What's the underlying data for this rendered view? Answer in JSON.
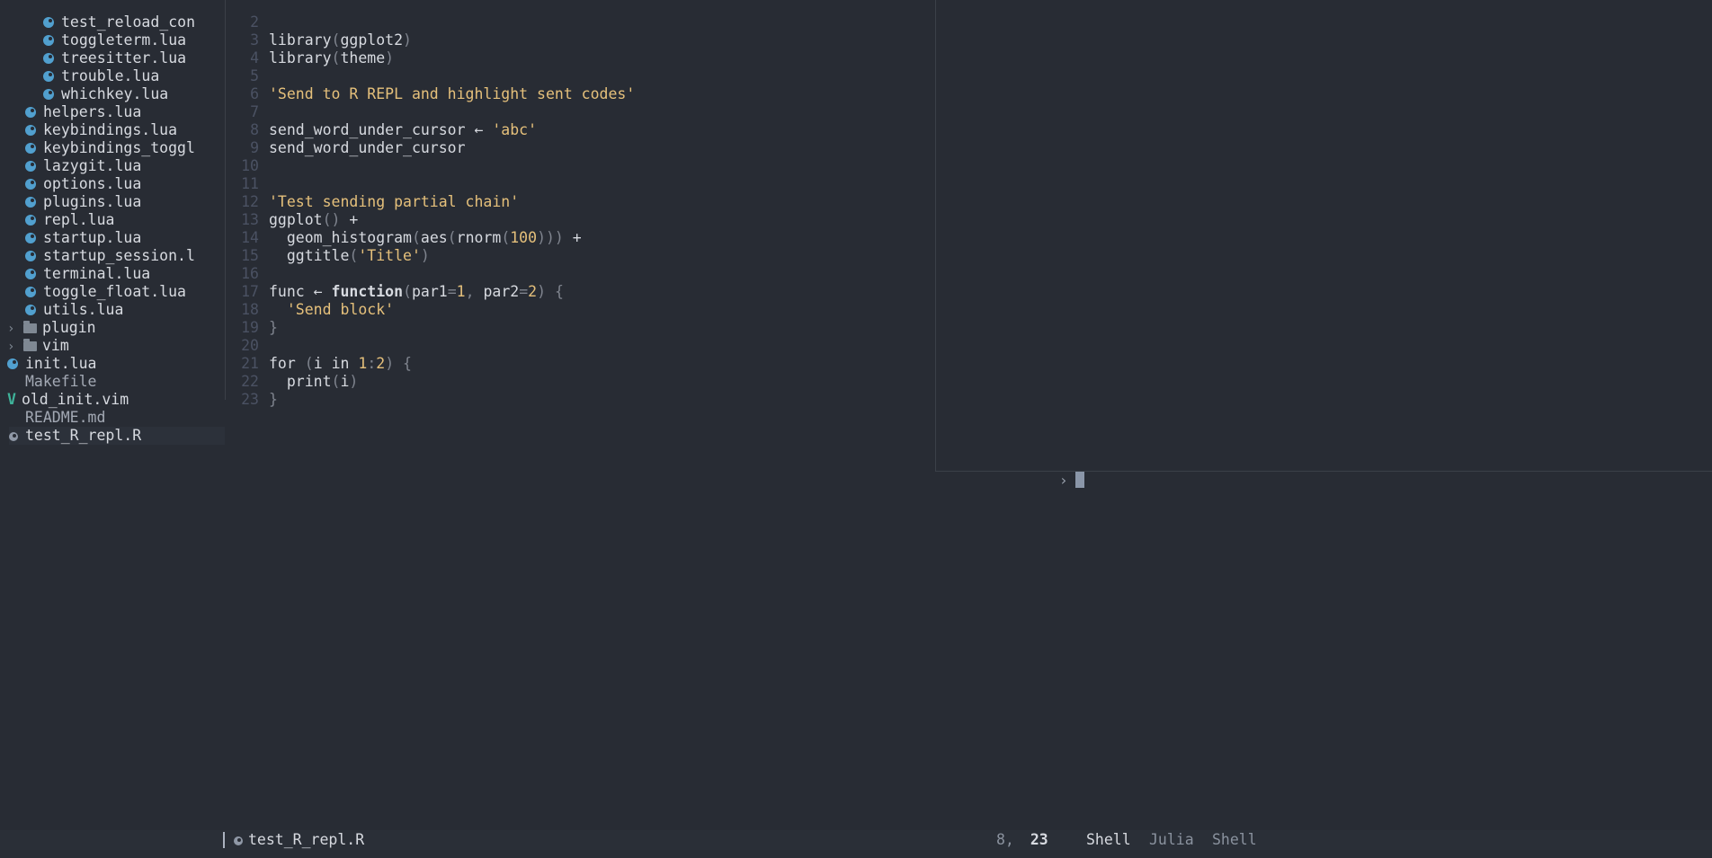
{
  "file_tree": {
    "items": [
      {
        "label": "test_reload_con",
        "indent": 2,
        "kind": "lua"
      },
      {
        "label": "toggleterm.lua",
        "indent": 2,
        "kind": "lua"
      },
      {
        "label": "treesitter.lua",
        "indent": 2,
        "kind": "lua"
      },
      {
        "label": "trouble.lua",
        "indent": 2,
        "kind": "lua"
      },
      {
        "label": "whichkey.lua",
        "indent": 2,
        "kind": "lua"
      },
      {
        "label": "helpers.lua",
        "indent": 1,
        "kind": "lua"
      },
      {
        "label": "keybindings.lua",
        "indent": 1,
        "kind": "lua"
      },
      {
        "label": "keybindings_toggl",
        "indent": 1,
        "kind": "lua"
      },
      {
        "label": "lazygit.lua",
        "indent": 1,
        "kind": "lua"
      },
      {
        "label": "options.lua",
        "indent": 1,
        "kind": "lua"
      },
      {
        "label": "plugins.lua",
        "indent": 1,
        "kind": "lua"
      },
      {
        "label": "repl.lua",
        "indent": 1,
        "kind": "lua"
      },
      {
        "label": "startup.lua",
        "indent": 1,
        "kind": "lua"
      },
      {
        "label": "startup_session.l",
        "indent": 1,
        "kind": "lua"
      },
      {
        "label": "terminal.lua",
        "indent": 1,
        "kind": "lua"
      },
      {
        "label": "toggle_float.lua",
        "indent": 1,
        "kind": "lua"
      },
      {
        "label": "utils.lua",
        "indent": 1,
        "kind": "lua"
      },
      {
        "label": "plugin",
        "indent": 0,
        "kind": "folder"
      },
      {
        "label": "vim",
        "indent": 0,
        "kind": "folder"
      },
      {
        "label": "init.lua",
        "indent": 0,
        "kind": "lua"
      },
      {
        "label": "Makefile",
        "indent": 0,
        "kind": "plain"
      },
      {
        "label": "old_init.vim",
        "indent": 0,
        "kind": "vim"
      },
      {
        "label": "README.md",
        "indent": 0,
        "kind": "plain"
      },
      {
        "label": "test_R_repl.R",
        "indent": 0,
        "kind": "r",
        "selected": true
      }
    ]
  },
  "editor": {
    "lines": [
      {
        "n": "2",
        "tokens": []
      },
      {
        "n": "3",
        "tokens": [
          [
            "fg",
            "library"
          ],
          [
            "pn",
            "("
          ],
          [
            "fg",
            "ggplot2"
          ],
          [
            "pn",
            ")"
          ]
        ]
      },
      {
        "n": "4",
        "tokens": [
          [
            "fg",
            "library"
          ],
          [
            "pn",
            "("
          ],
          [
            "fg",
            "theme"
          ],
          [
            "pn",
            ")"
          ]
        ]
      },
      {
        "n": "5",
        "tokens": []
      },
      {
        "n": "6",
        "tokens": [
          [
            "str",
            "'Send to R REPL and highlight sent codes'"
          ]
        ]
      },
      {
        "n": "7",
        "tokens": []
      },
      {
        "n": "8",
        "tokens": [
          [
            "fg",
            "send_word_under_cursor "
          ],
          [
            "fg",
            "← "
          ],
          [
            "str",
            "'abc'"
          ]
        ]
      },
      {
        "n": "9",
        "tokens": [
          [
            "fg",
            "send_word_under_cursor"
          ]
        ]
      },
      {
        "n": "10",
        "tokens": []
      },
      {
        "n": "11",
        "tokens": []
      },
      {
        "n": "12",
        "tokens": [
          [
            "str",
            "'Test sending partial chain'"
          ]
        ]
      },
      {
        "n": "13",
        "tokens": [
          [
            "fg",
            "ggplot"
          ],
          [
            "pn",
            "() "
          ],
          [
            "fg",
            "+"
          ]
        ]
      },
      {
        "n": "14",
        "tokens": [
          [
            "fg",
            "  geom_histogram"
          ],
          [
            "pn",
            "("
          ],
          [
            "fg",
            "aes"
          ],
          [
            "pn",
            "("
          ],
          [
            "fg",
            "rnorm"
          ],
          [
            "pn",
            "("
          ],
          [
            "num",
            "100"
          ],
          [
            "pn",
            ")))"
          ],
          [
            "fg",
            " +"
          ]
        ]
      },
      {
        "n": "15",
        "tokens": [
          [
            "fg",
            "  ggtitle"
          ],
          [
            "pn",
            "("
          ],
          [
            "str",
            "'Title'"
          ],
          [
            "pn",
            ")"
          ]
        ]
      },
      {
        "n": "16",
        "tokens": []
      },
      {
        "n": "17",
        "tokens": [
          [
            "fg",
            "func "
          ],
          [
            "fg",
            "← "
          ],
          [
            "kw",
            "function"
          ],
          [
            "pn",
            "("
          ],
          [
            "fg",
            "par1"
          ],
          [
            "pn",
            "="
          ],
          [
            "num",
            "1"
          ],
          [
            "pn",
            ", "
          ],
          [
            "fg",
            "par2"
          ],
          [
            "pn",
            "="
          ],
          [
            "num",
            "2"
          ],
          [
            "pn",
            ") {"
          ]
        ]
      },
      {
        "n": "18",
        "tokens": [
          [
            "str",
            "  'Send block'"
          ]
        ]
      },
      {
        "n": "19",
        "tokens": [
          [
            "pn",
            "}"
          ]
        ]
      },
      {
        "n": "20",
        "tokens": []
      },
      {
        "n": "21",
        "tokens": [
          [
            "fg",
            "for "
          ],
          [
            "pn",
            "("
          ],
          [
            "fg",
            "i "
          ],
          [
            "fg",
            "in "
          ],
          [
            "num",
            "1"
          ],
          [
            "pn",
            ":"
          ],
          [
            "num",
            "2"
          ],
          [
            "pn",
            ") {"
          ]
        ]
      },
      {
        "n": "22",
        "tokens": [
          [
            "fg",
            "  print"
          ],
          [
            "pn",
            "("
          ],
          [
            "fg",
            "i"
          ],
          [
            "pn",
            ")"
          ]
        ]
      },
      {
        "n": "23",
        "tokens": [
          [
            "pn",
            "}"
          ]
        ]
      }
    ]
  },
  "terminal": {
    "prompt": "›"
  },
  "statusline": {
    "filename": "test_R_repl.R",
    "line": "8,",
    "col": "23",
    "tabs": [
      {
        "label": "Shell",
        "active": true
      },
      {
        "label": "Julia",
        "active": false
      },
      {
        "label": "Shell",
        "active": false
      }
    ]
  },
  "colors": {
    "background": "#282c34",
    "string": "#e5c07b",
    "lua_icon": "#51a0cf",
    "vim_icon": "#3fb39a"
  }
}
